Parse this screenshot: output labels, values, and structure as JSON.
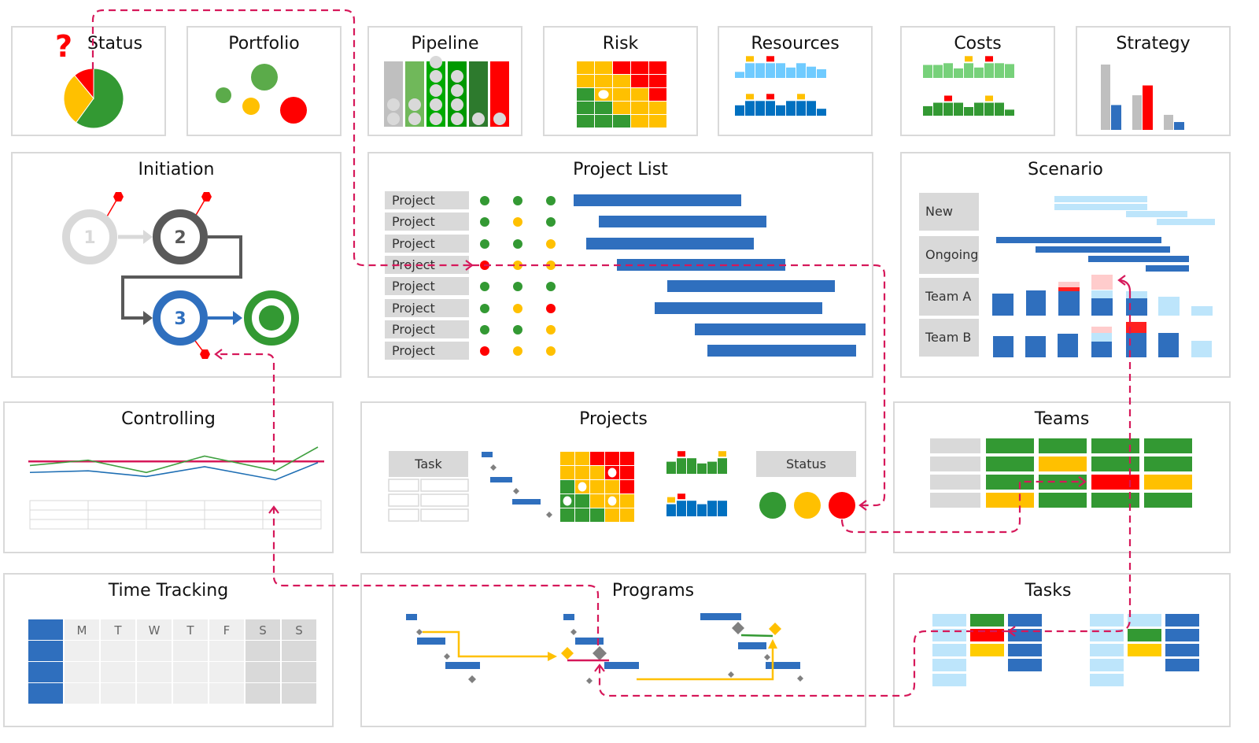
{
  "colors": {
    "green": "#339933",
    "light_green": "#5bab4a",
    "yellow": "#ffc000",
    "red": "#ff0000",
    "blue": "#2f6fbe",
    "light_blue": "#bde5fb",
    "sky": "#6fcbff",
    "gray": "#bfbfbf",
    "light_gray": "#d9d9d9",
    "dark_gray": "#595959",
    "connector": "#d6185a"
  },
  "panels": {
    "status": {
      "title": "Status",
      "question_mark": "?",
      "pie": [
        {
          "label": "green",
          "share": 0.6
        },
        {
          "label": "yellow",
          "share": 0.29
        },
        {
          "label": "red",
          "share": 0.11
        }
      ]
    },
    "portfolio": {
      "title": "Portfolio",
      "bubbles": [
        {
          "color": "green",
          "size": "large"
        },
        {
          "color": "green",
          "size": "small"
        },
        {
          "color": "yellow",
          "size": "small"
        },
        {
          "color": "red",
          "size": "large"
        }
      ]
    },
    "pipeline": {
      "title": "Pipeline",
      "columns": [
        {
          "color": "#bfbfbf",
          "items": 2
        },
        {
          "color": "#70b85a",
          "items": 2
        },
        {
          "color": "#00aa00",
          "items": 5
        },
        {
          "color": "#009900",
          "items": 4
        },
        {
          "color": "#2d7a2d",
          "items": 1
        },
        {
          "color": "#ff0000",
          "items": 1
        }
      ]
    },
    "risk": {
      "title": "Risk",
      "matrix": [
        [
          "Y",
          "Y",
          "R",
          "R",
          "R"
        ],
        [
          "Y",
          "Y",
          "Y",
          "R",
          "R"
        ],
        [
          "G",
          "Y",
          "Y",
          "Y",
          "R"
        ],
        [
          "G",
          "G",
          "Y",
          "Y",
          "Y"
        ],
        [
          "G",
          "G",
          "G",
          "Y",
          "Y"
        ]
      ],
      "marker": {
        "row": 2,
        "col": 1
      }
    },
    "resources": {
      "title": "Resources",
      "top": [
        0.35,
        0.85,
        0.85,
        0.85,
        0.85,
        0.6,
        0.85,
        0.65,
        0.5
      ],
      "top_flags": [
        null,
        "Y",
        null,
        "R",
        null,
        null,
        null,
        null,
        null
      ],
      "bottom": [
        0.6,
        0.85,
        0.85,
        0.85,
        0.6,
        0.85,
        0.85,
        0.85,
        0.4
      ],
      "bottom_flags": [
        null,
        "Y",
        null,
        "R",
        null,
        null,
        "Y",
        null,
        null
      ]
    },
    "costs": {
      "title": "Costs",
      "top": [
        0.75,
        0.75,
        0.85,
        0.55,
        0.85,
        0.6,
        0.85,
        0.85,
        0.8
      ],
      "top_flags": [
        null,
        null,
        null,
        null,
        "Y",
        null,
        "R",
        null,
        null
      ],
      "bottom": [
        0.55,
        0.75,
        0.75,
        0.75,
        0.5,
        0.75,
        0.75,
        0.75,
        0.35
      ],
      "bottom_flags": [
        null,
        null,
        "R",
        null,
        null,
        null,
        "Y",
        null,
        null
      ]
    },
    "strategy": {
      "title": "Strategy",
      "groups": [
        {
          "plan": 1.0,
          "actual": 0.38,
          "actual_color": "blue"
        },
        {
          "plan": 0.53,
          "actual": 0.68,
          "actual_color": "red"
        },
        {
          "plan": 0.23,
          "actual": 0.12,
          "actual_color": "blue"
        }
      ]
    },
    "initiation": {
      "title": "Initiation",
      "steps": [
        {
          "label": "1",
          "state": "done"
        },
        {
          "label": "2",
          "state": "active"
        },
        {
          "label": "3",
          "state": "current"
        },
        {
          "label": "",
          "state": "goal"
        }
      ]
    },
    "project_list": {
      "title": "Project List",
      "rows": [
        {
          "name": "Project",
          "status": [
            "G",
            "G",
            "G"
          ],
          "start": 0.0,
          "end": 0.54
        },
        {
          "name": "Project",
          "status": [
            "G",
            "Y",
            "G"
          ],
          "start": 0.08,
          "end": 0.62
        },
        {
          "name": "Project",
          "status": [
            "G",
            "G",
            "Y"
          ],
          "start": 0.04,
          "end": 0.58
        },
        {
          "name": "Project",
          "status": [
            "R",
            "Y",
            "Y"
          ],
          "start": 0.14,
          "end": 0.68
        },
        {
          "name": "Project",
          "status": [
            "G",
            "G",
            "G"
          ],
          "start": 0.3,
          "end": 0.84
        },
        {
          "name": "Project",
          "status": [
            "G",
            "Y",
            "R"
          ],
          "start": 0.26,
          "end": 0.8
        },
        {
          "name": "Project",
          "status": [
            "G",
            "G",
            "Y"
          ],
          "start": 0.39,
          "end": 0.94
        },
        {
          "name": "Project",
          "status": [
            "R",
            "Y",
            "Y"
          ],
          "start": 0.43,
          "end": 0.91
        }
      ]
    },
    "scenario": {
      "title": "Scenario",
      "rows": [
        "New",
        "Ongoing",
        "Team A",
        "Team B"
      ]
    },
    "controlling": {
      "title": "Controlling",
      "line_green": [
        0.55,
        0.68,
        0.38,
        0.78,
        0.42,
        1.0
      ],
      "line_blue": [
        0.38,
        0.42,
        0.28,
        0.52,
        0.2,
        0.62
      ],
      "threshold": 0.65
    },
    "projects": {
      "title": "Projects",
      "task_label": "Task",
      "status_label": "Status",
      "status_lights": [
        "G",
        "Y",
        "R"
      ],
      "matrix": [
        [
          "Y",
          "Y",
          "R",
          "R",
          "R"
        ],
        [
          "Y",
          "Y",
          "Y",
          "R",
          "R"
        ],
        [
          "G",
          "Y",
          "Y",
          "Y",
          "R"
        ],
        [
          "G",
          "G",
          "Y",
          "Y",
          "Y"
        ],
        [
          "G",
          "G",
          "G",
          "Y",
          "Y"
        ]
      ]
    },
    "teams": {
      "title": "Teams",
      "grid": [
        [
          "G",
          "G",
          "G",
          "G"
        ],
        [
          "G",
          "Y",
          "G",
          "G"
        ],
        [
          "G",
          "G",
          "R",
          "Y"
        ],
        [
          "Y",
          "G",
          "G",
          "G"
        ]
      ]
    },
    "time_tracking": {
      "title": "Time Tracking",
      "days": [
        "M",
        "T",
        "W",
        "T",
        "F",
        "S",
        "S"
      ],
      "rows": 3
    },
    "programs": {
      "title": "Programs"
    },
    "tasks": {
      "title": "Tasks",
      "board1": [
        [
          "L",
          "G",
          "B"
        ],
        [
          "L",
          "R",
          "B"
        ],
        [
          "L",
          "Y",
          "B"
        ],
        [
          "L",
          null,
          "B"
        ],
        [
          "L",
          null,
          null
        ]
      ],
      "board2": [
        [
          "L",
          "L",
          "B"
        ],
        [
          "L",
          "G",
          "B"
        ],
        [
          "L",
          "Y",
          "B"
        ],
        [
          "L",
          null,
          "B"
        ],
        [
          "L",
          null,
          null
        ]
      ]
    }
  }
}
